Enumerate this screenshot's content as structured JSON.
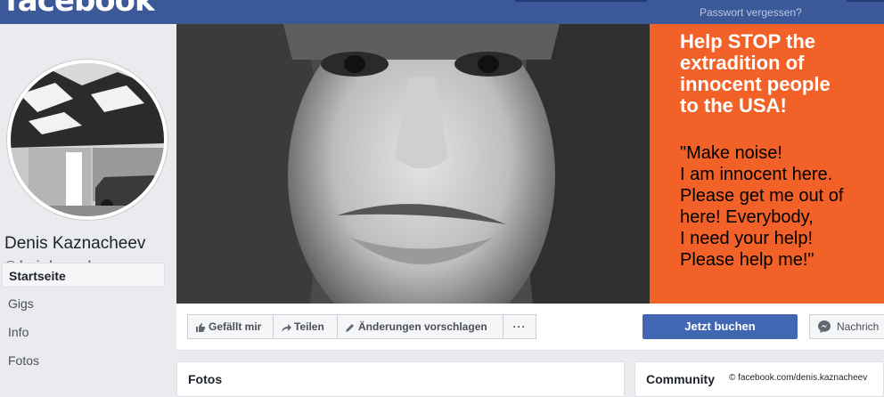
{
  "header": {
    "logo": "facebook",
    "forgot_password": "Passwort vergessen?"
  },
  "profile": {
    "name": "Denis Kaznacheev",
    "handle": "@denis.kaznacheev"
  },
  "sidebar": {
    "items": [
      {
        "label": "Startseite",
        "active": true
      },
      {
        "label": "Gigs",
        "active": false
      },
      {
        "label": "Info",
        "active": false
      },
      {
        "label": "Fotos",
        "active": false
      }
    ]
  },
  "cover": {
    "headline": "Help STOP the\nextradition of\ninnocent people\nto the USA!",
    "quote": "\"Make noise!\nI am innocent here.\nPlease get me out of\nhere! Everybody,\nI need your help!\nPlease help me!\"",
    "colors": {
      "panel": "#f26128"
    }
  },
  "actions": {
    "like": "Gefällt mir",
    "share": "Teilen",
    "suggest": "Änderungen vorschlagen",
    "more": "···",
    "book": "Jetzt buchen",
    "message": "Nachrich"
  },
  "cards": {
    "photos": "Fotos",
    "community": "Community"
  },
  "credit": "© facebook.com/denis.kaznacheev",
  "colors": {
    "brand": "#3b5998",
    "primary_button": "#4267b2",
    "background": "#e9ebee"
  },
  "icons": [
    "thumbs-up-icon",
    "share-arrow-icon",
    "pencil-icon",
    "messenger-icon"
  ]
}
